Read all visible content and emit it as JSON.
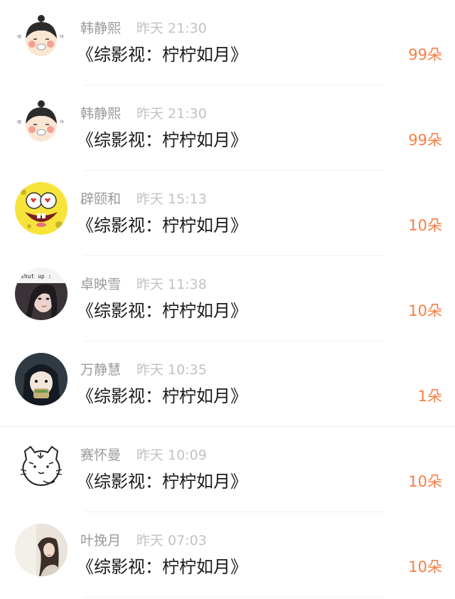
{
  "items": [
    {
      "name": "韩静熙",
      "time": "昨天 21:30",
      "title": "《综影视：柠柠如月》",
      "amount": "99朵",
      "avatar": "girl-cartoon-avatar-icon"
    },
    {
      "name": "韩静熙",
      "time": "昨天 21:30",
      "title": "《综影视：柠柠如月》",
      "amount": "99朵",
      "avatar": "girl-cartoon-avatar-icon"
    },
    {
      "name": "辟颐和",
      "time": "昨天 15:13",
      "title": "《综影视：柠柠如月》",
      "amount": "10朵",
      "avatar": "spongebob-avatar-icon"
    },
    {
      "name": "卓映雪",
      "time": "昨天 11:38",
      "title": "《综影视：柠柠如月》",
      "amount": "10朵",
      "avatar": "photo-girl-avatar-icon",
      "avatar_caption": "shut up :"
    },
    {
      "name": "万静慧",
      "time": "昨天 10:35",
      "title": "《综影视：柠柠如月》",
      "amount": "1朵",
      "avatar": "anime-eating-avatar-icon"
    },
    {
      "name": "赛怀曼",
      "time": "昨天 10:09",
      "title": "《综影视：柠柠如月》",
      "amount": "10朵",
      "avatar": "tiger-sketch-avatar-icon"
    },
    {
      "name": "叶挽月",
      "time": "昨天 07:03",
      "title": "《综影视：柠柠如月》",
      "amount": "10朵",
      "avatar": "photo-woman-avatar-icon"
    }
  ],
  "colors": {
    "name": "#9a9a9a",
    "time": "#c2c2c2",
    "title": "#1a1a1a",
    "amount": "#f57f45",
    "divider": "#f0f0f0"
  }
}
